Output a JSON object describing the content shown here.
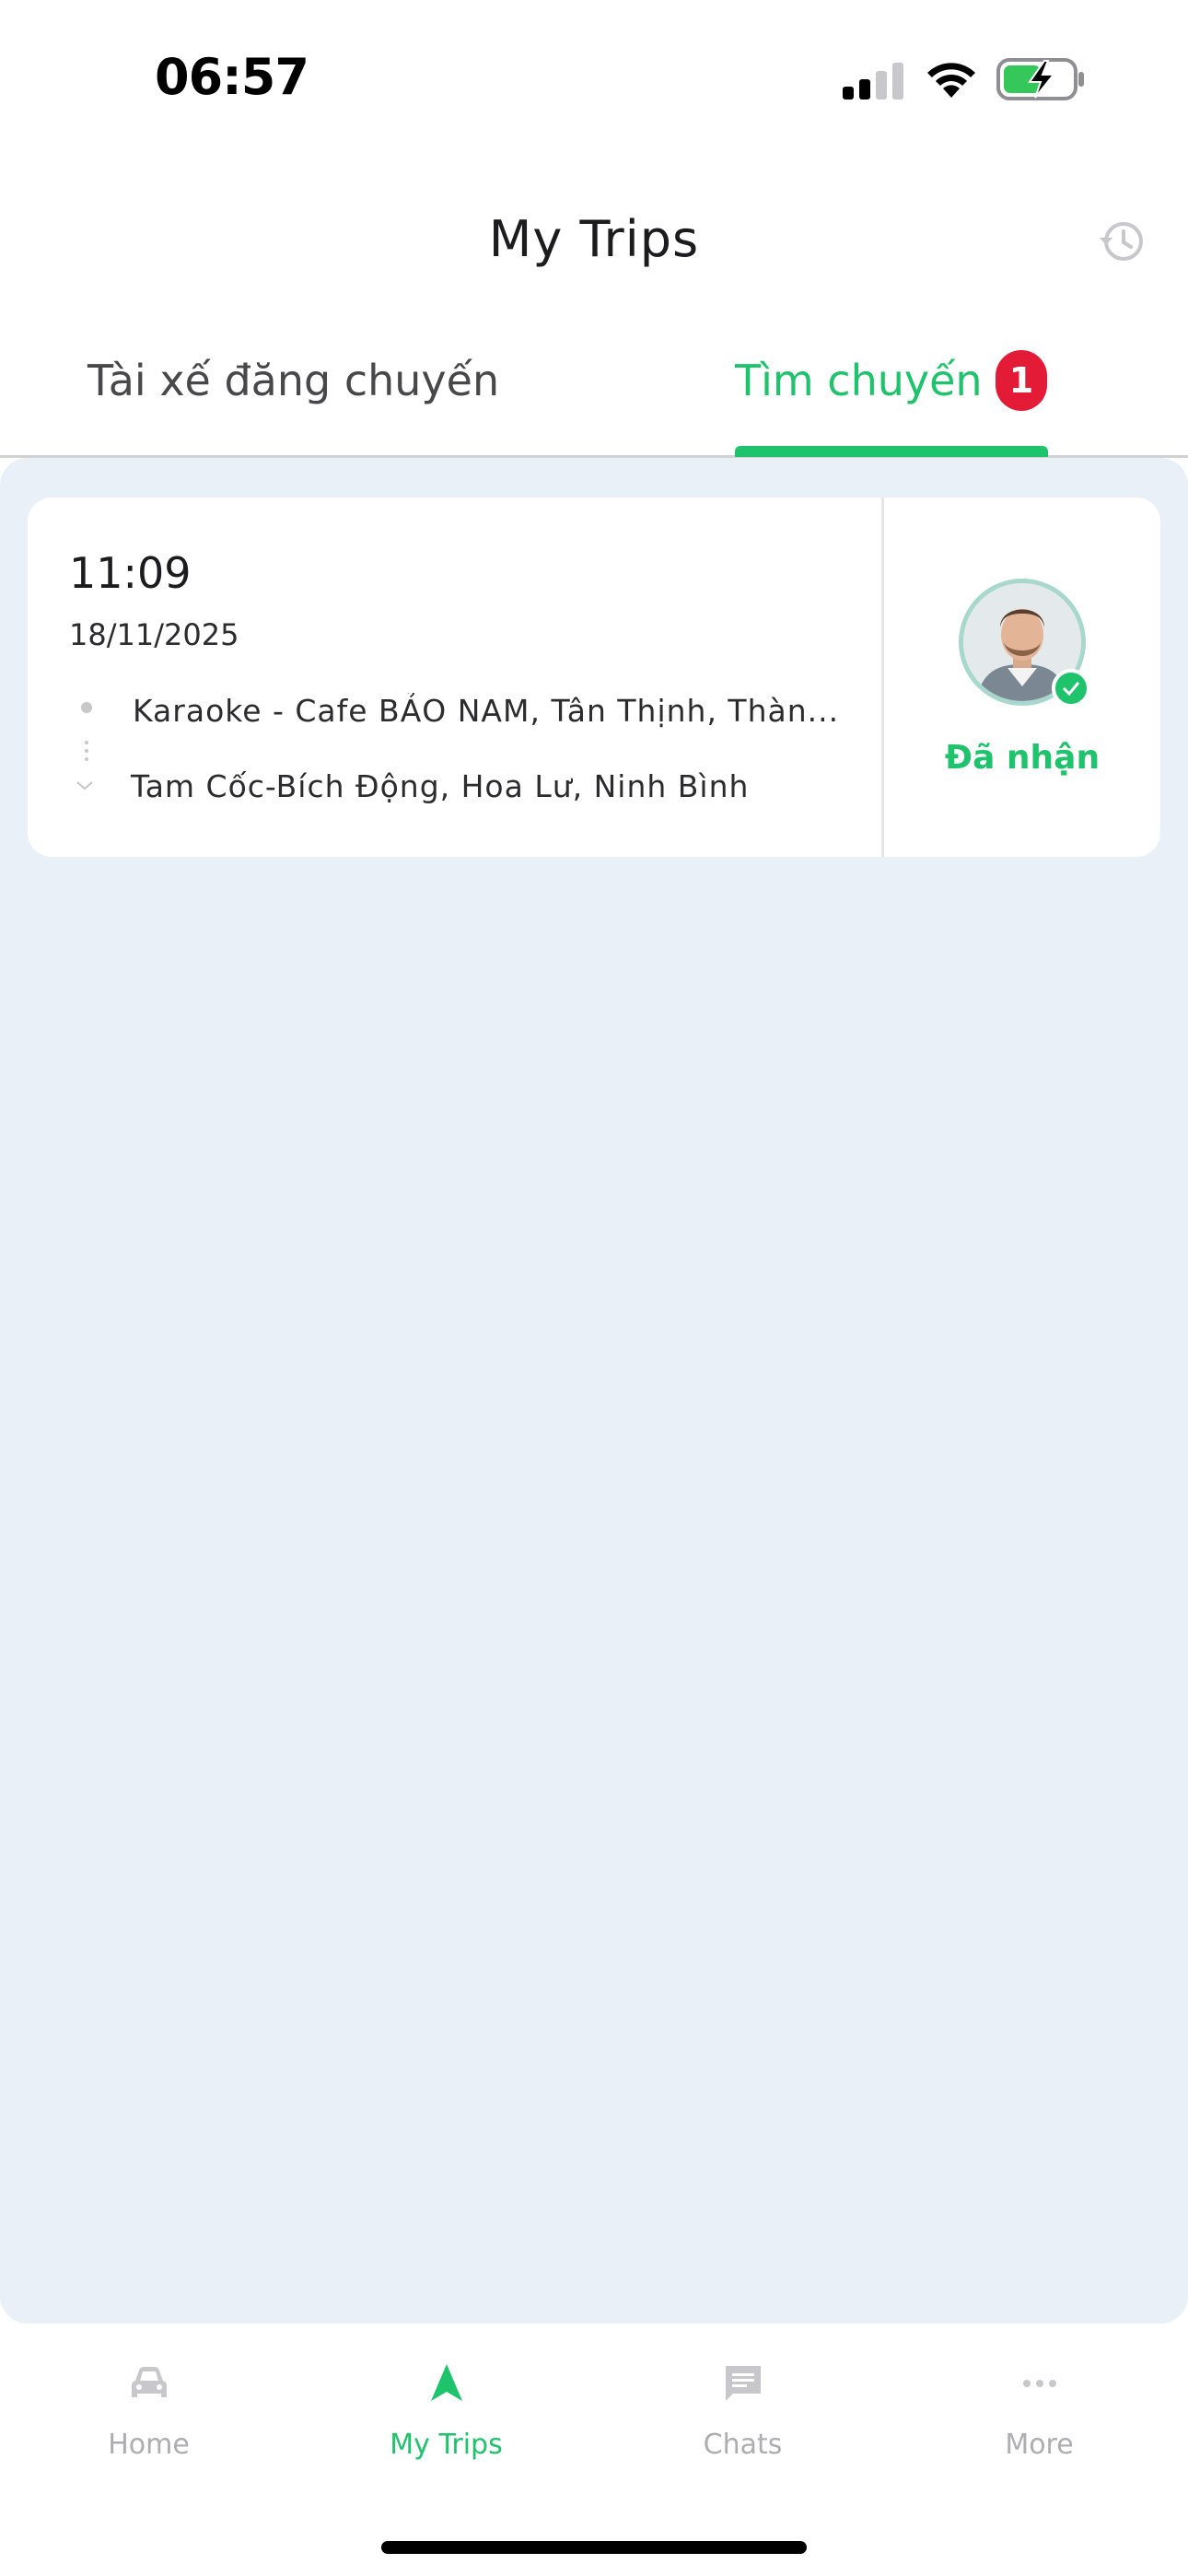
{
  "status_bar": {
    "time": "06:57",
    "signal_icon": "cellular-signal-icon",
    "wifi_icon": "wifi-icon",
    "battery_icon": "battery-charging-icon"
  },
  "header": {
    "title": "My Trips",
    "history_icon": "history-icon"
  },
  "tabs": [
    {
      "label": "Tài xế đăng chuyến",
      "active": false
    },
    {
      "label": "Tìm chuyến",
      "active": true,
      "badge": "1"
    }
  ],
  "trip": {
    "time": "11:09",
    "date": "18/11/2025",
    "origin": "Karaoke - Cafe BẢO NAM, Tân Thịnh, Thàn...",
    "destination": "Tam Cốc-Bích Động, Hoa Lư, Ninh Bình",
    "status": "Đã nhận"
  },
  "bottom_nav": [
    {
      "label": "Home",
      "icon": "car-icon",
      "active": false
    },
    {
      "label": "My Trips",
      "icon": "navigation-arrow-icon",
      "active": true
    },
    {
      "label": "Chats",
      "icon": "chat-icon",
      "active": false
    },
    {
      "label": "More",
      "icon": "more-dots-icon",
      "active": false
    }
  ],
  "colors": {
    "accent": "#1ec36b",
    "badge": "#e31b37",
    "background": "#e9f0f7"
  }
}
